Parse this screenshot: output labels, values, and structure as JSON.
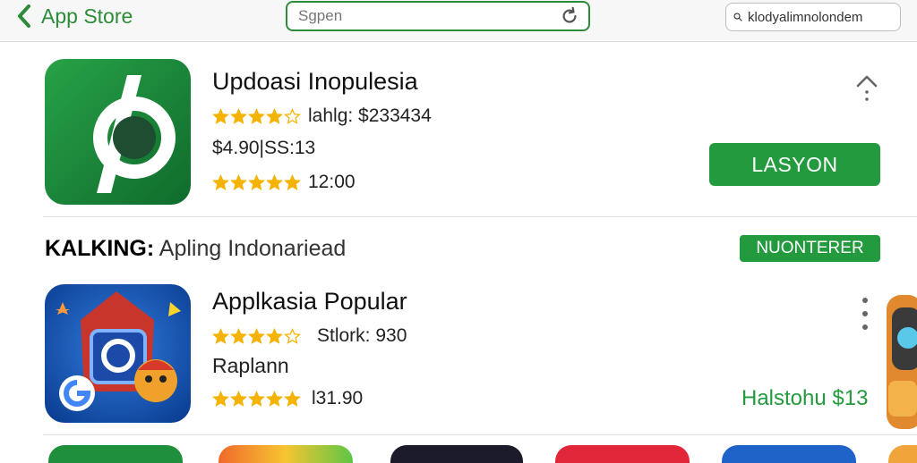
{
  "header": {
    "back_label": "App Store",
    "search_value": "Sgpen",
    "right_search_value": "klodyalimnolondem"
  },
  "featured": {
    "title": "Updoasi Inopulesia",
    "rating_text": "lahlg: $233434",
    "price_text": "$4.90|SS:13",
    "reviews_text": "12:00",
    "action_label": "LASYON"
  },
  "section": {
    "heading": "KALKING:",
    "subheading": "Apling Indonariead",
    "action_label": "NUONTERER"
  },
  "popular": {
    "title": "Applkasia Popular",
    "rating_text": "Stlork: 930",
    "subtitle": "Raplann",
    "reviews_text": "l31.90",
    "price_text": "Halstohu $13"
  },
  "colors": {
    "accent": "#239a3d",
    "star": "#f5b301"
  },
  "icons": [
    "back-chevron-icon",
    "refresh-icon",
    "search-icon",
    "star-icon",
    "chevron-up-icon",
    "more-vertical-icon"
  ]
}
